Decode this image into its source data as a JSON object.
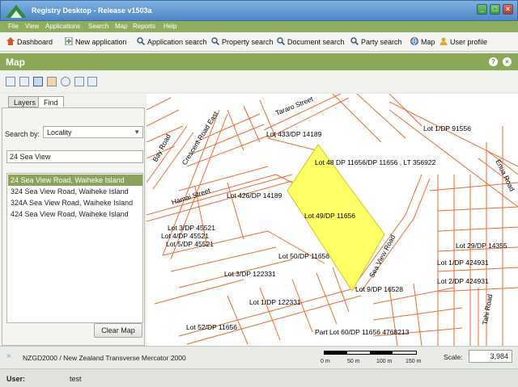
{
  "window": {
    "title": "Registry Desktop - Release v1503a",
    "min_label": "_",
    "max_label": "□",
    "close_label": "×"
  },
  "menu": [
    "File",
    "View",
    "Applications",
    "Search",
    "Map",
    "Reports",
    "Help"
  ],
  "toolbar": {
    "dashboard": "Dashboard",
    "new_application": "New application",
    "application_search": "Application search",
    "property_search": "Property search",
    "document_search": "Document search",
    "party_search": "Party search",
    "map": "Map",
    "user_profile": "User profile"
  },
  "map_header": {
    "title": "Map",
    "help_label": "?",
    "close_label": "×"
  },
  "find_panel": {
    "tabs": [
      "Layers",
      "Find"
    ],
    "active_tab": "Find",
    "search_by_label": "Search by:",
    "search_by_value": "Locality",
    "query": "24 Sea View",
    "results": [
      "24 Sea View Road, Waiheke Island",
      "324 Sea View Road, Waiheke Island",
      "324A Sea View Road, Waiheke Island",
      "424 Sea View Road, Waiheke Island"
    ],
    "selected_index": 0,
    "clear_button": "Clear Map"
  },
  "map": {
    "parcel_color": "#ee6a2e",
    "highlight_fill": "#ffff66",
    "highlight_stroke": "#c8c820",
    "labels": {
      "tararo_st": "Tararo Street",
      "crescent_rd": "Crescent Road East",
      "bay_rd": "Bay Road",
      "hamai_st": "Hamai Street",
      "sea_view_rd": "Sea View Road",
      "enua_rd": "Enua Road",
      "tahi_rd": "Tahi Road",
      "lot433": "Lot 433/DP 14189",
      "lot1_91556": "Lot 1/DP 91556",
      "lot48": "Lot 48 DP 11656/DP 11656 , LT 356922",
      "lot426": "Lot 426/DP 14189",
      "lot49": "Lot 49/DP 11656",
      "lot3_45521": "Lot 3/DP 45521",
      "lot4_45521": "Lot 4/DP 45521",
      "lot5_45521": "Lot 5/DP 45521",
      "lot50": "Lot 50/DP 11656",
      "lot3_122331": "Lot 3/DP 122331",
      "lot1_122331": "Lot 1/DP 122331",
      "lot9": "Lot 9/DP 16528",
      "lot52": "Lot 52/DP 11656",
      "part60": "Part Lot 60/DP 11656 4768213",
      "lot29": "Lot 29/DP 14355",
      "lot1_424931": "Lot 1/DP 424931",
      "lot2_424931": "Lot 2/DP 424931"
    }
  },
  "status": {
    "projection": "NZGD2000 / New Zealand Transverse Mercator 2000",
    "scale_ticks": [
      "0 m",
      "50 m",
      "100 m",
      "150 m"
    ],
    "scale_label": "Scale:",
    "scale_value": "3,984"
  },
  "user": {
    "label": "User:",
    "value": "test"
  },
  "icons": {
    "dashboard": "home-icon",
    "new_application": "new-document-icon",
    "search": "magnifier-icon",
    "map": "globe-icon",
    "user_profile": "user-icon"
  }
}
